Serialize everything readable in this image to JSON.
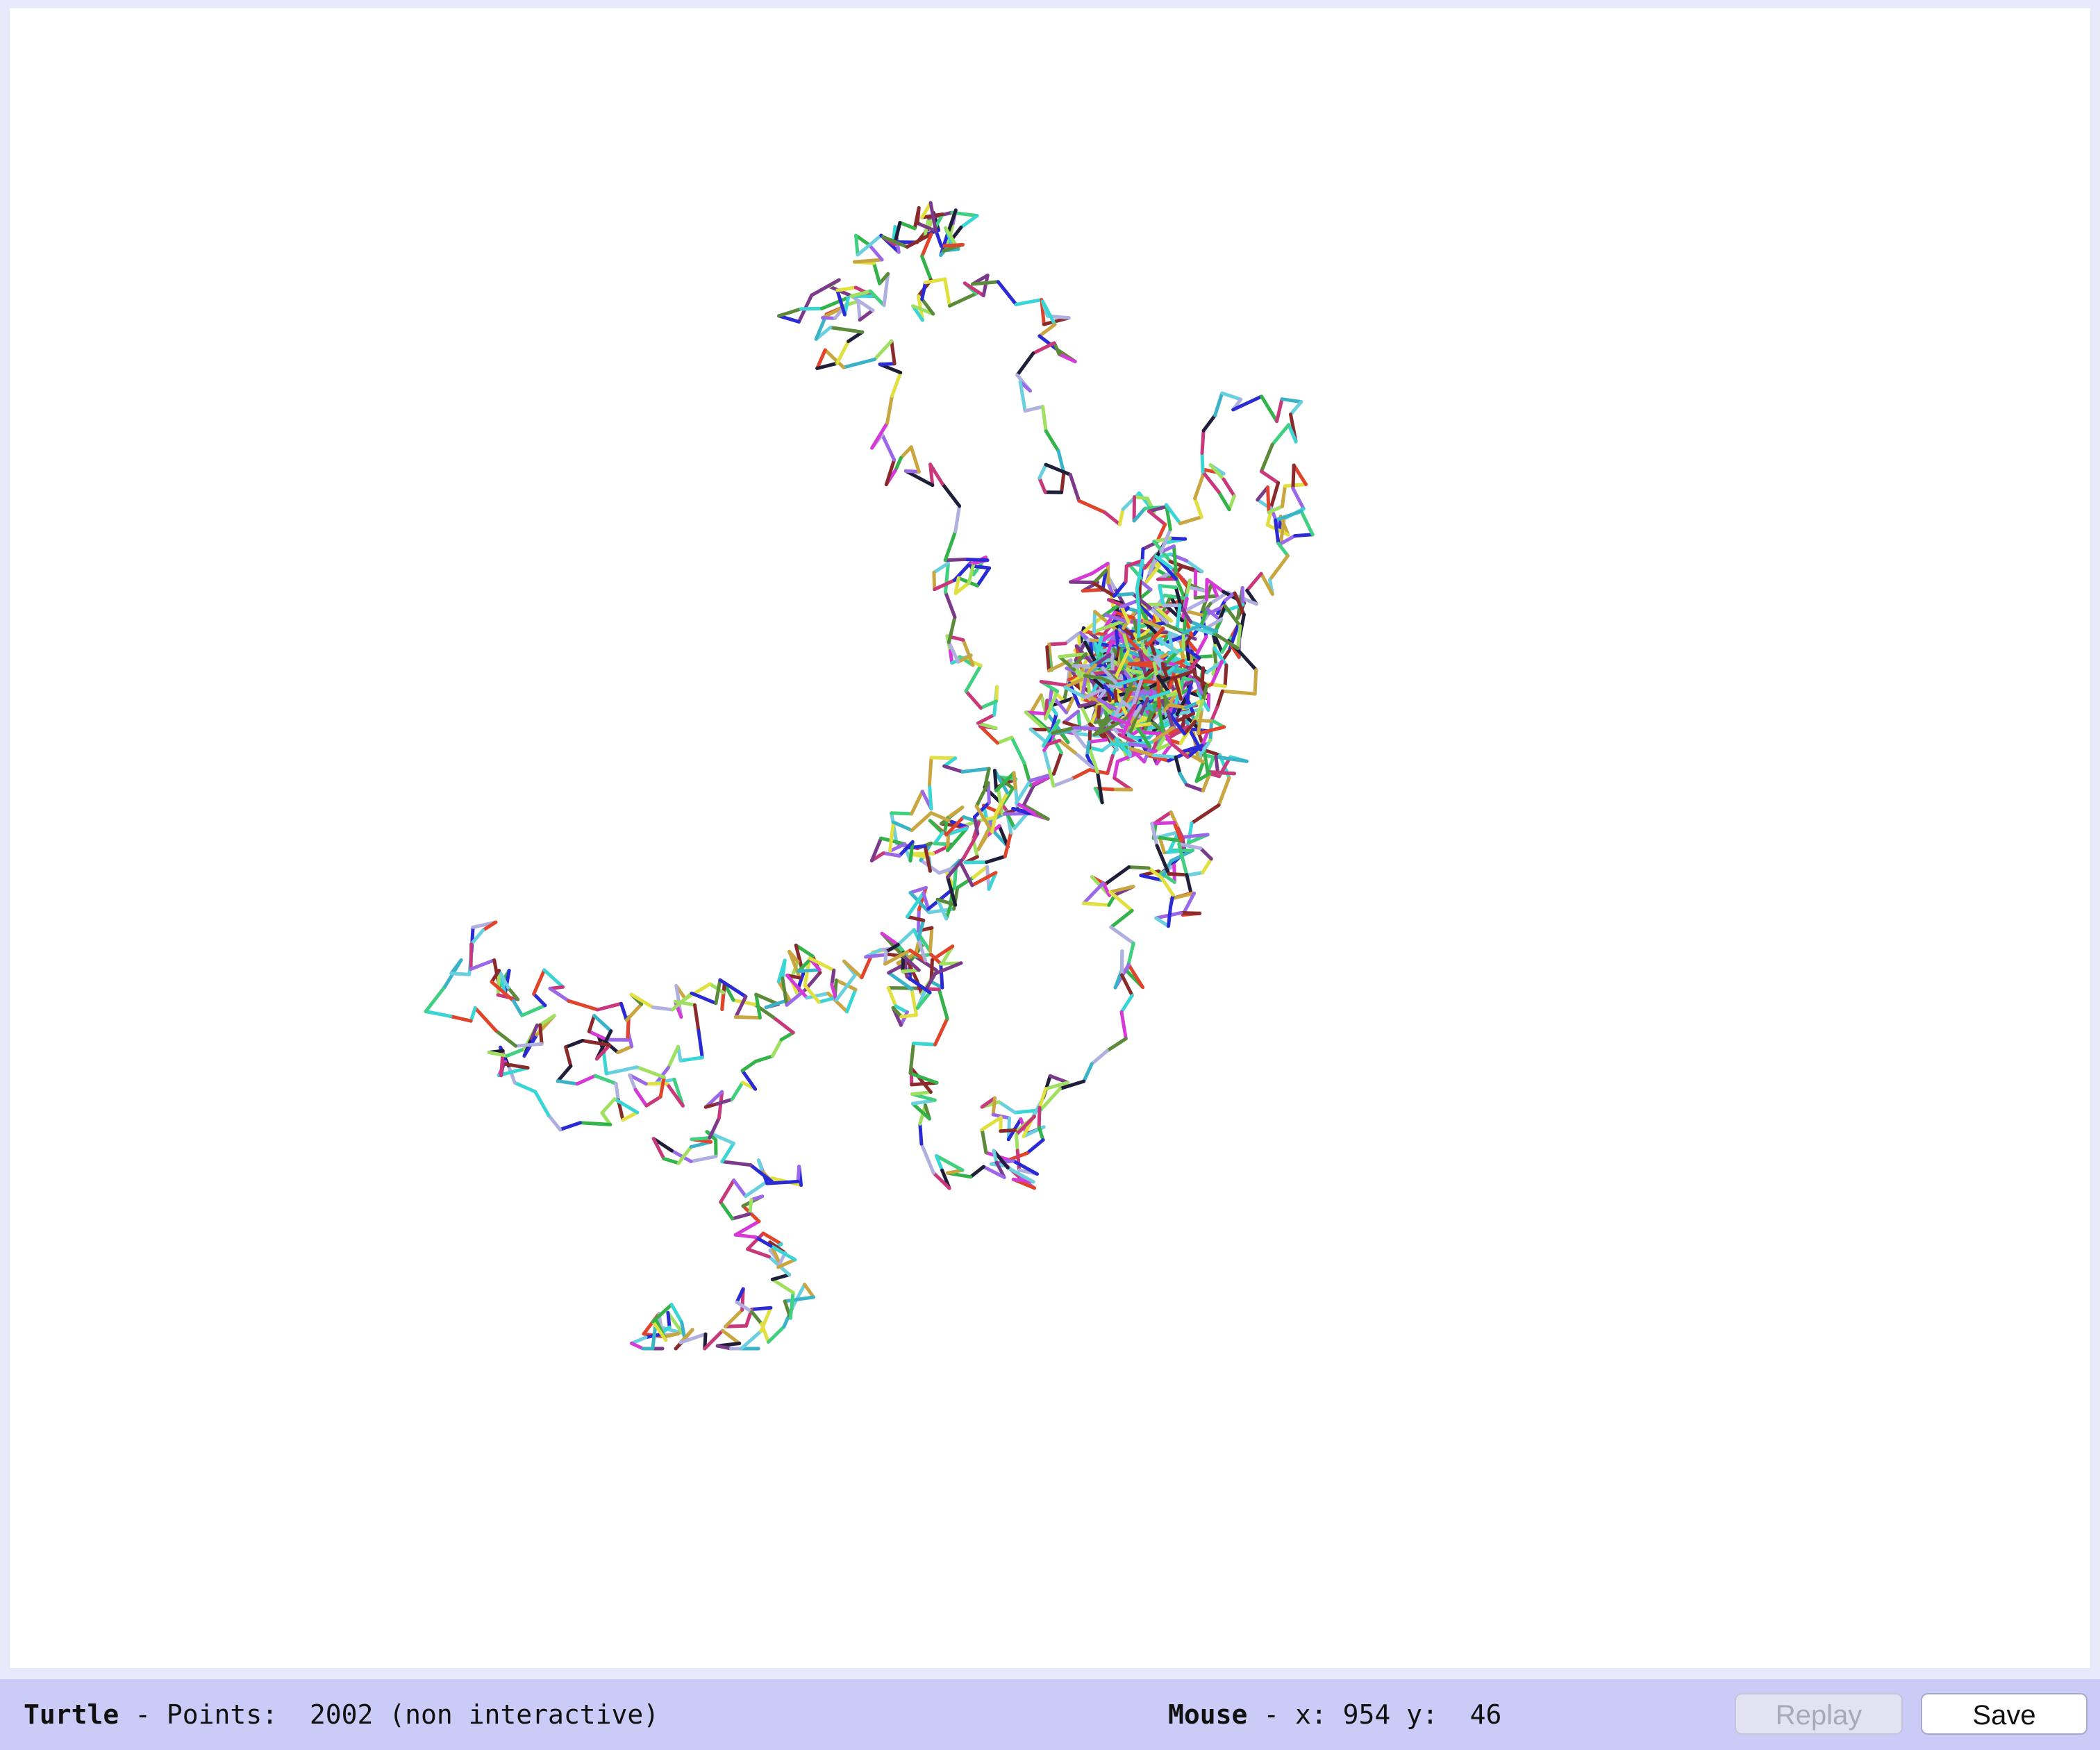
{
  "status_bar": {
    "turtle_label": "Turtle",
    "turtle_text": " - Points:  2002 (non interactive)",
    "mouse_label": "Mouse",
    "mouse_text": " - x: 954 y:  46"
  },
  "buttons": {
    "replay_label": "Replay",
    "save_label": "Save"
  },
  "colors": {
    "canvas_background": "#ffffff",
    "status_bar_background": "#cbcbf7",
    "window_background": "#e9e9fb"
  }
}
